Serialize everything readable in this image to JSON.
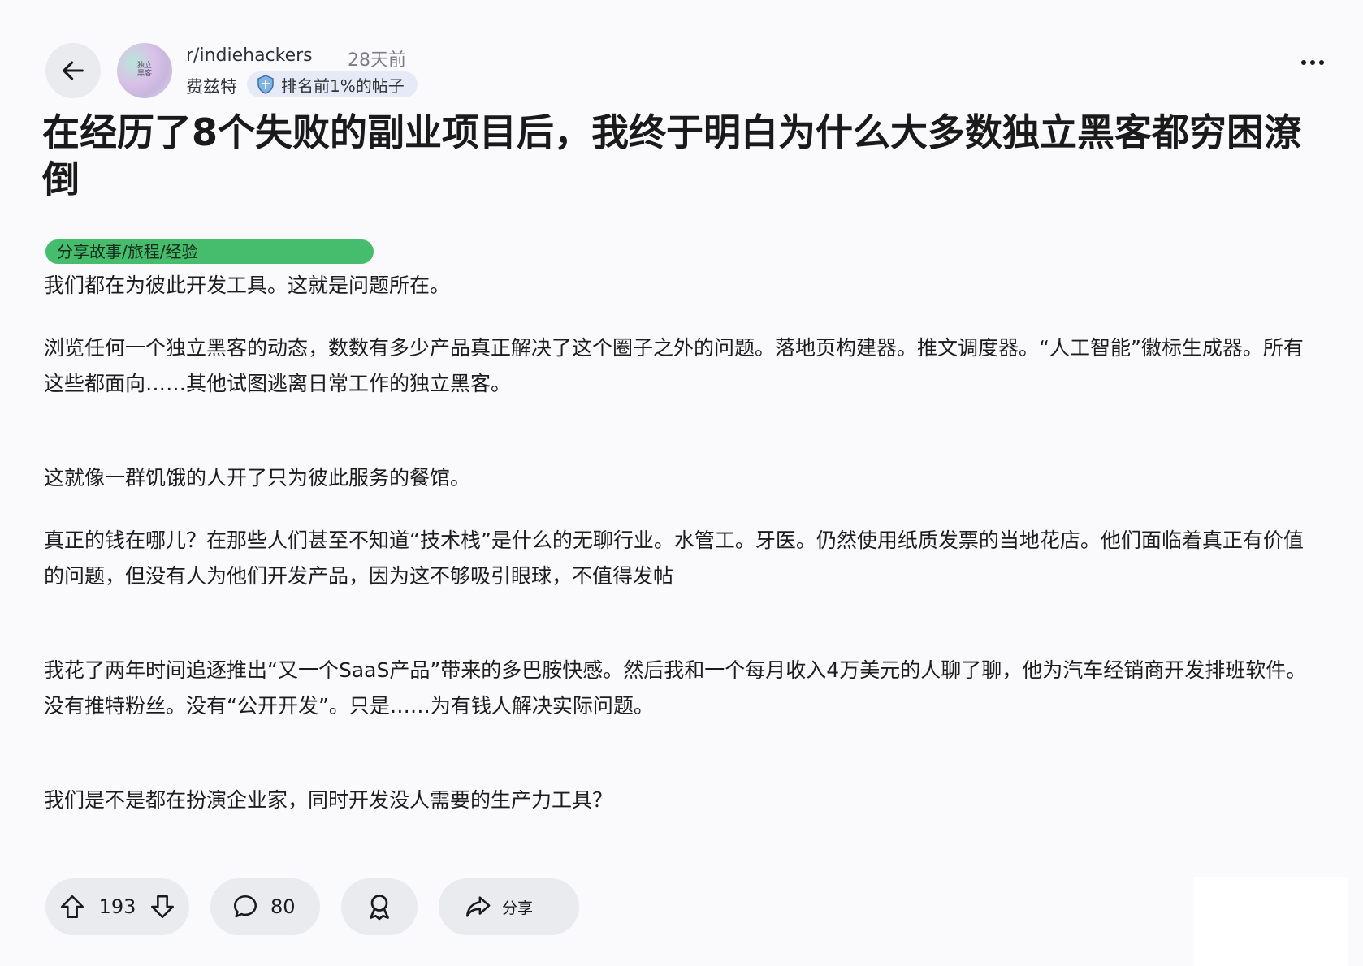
{
  "header": {
    "subreddit": "r/indiehackers",
    "time_ago": "28天前",
    "author": "费兹特",
    "rank_badge": "排名前1%的帖子",
    "avatar_text_line1": "独立",
    "avatar_text_line2": "黑客"
  },
  "post": {
    "title": "在经历了8个失败的副业项目后，我终于明白为什么大多数独立黑客都穷困潦倒",
    "flair": "分享故事/旅程/经验",
    "paragraphs": [
      "我们都在为彼此开发工具。这就是问题所在。",
      "浏览任何一个独立黑客的动态，数数有多少产品真正解决了这个圈子之外的问题。落地页构建器。推文调度器。“人工智能”徽标生成器。所有这些都面向……其他试图逃离日常工作的独立黑客。",
      "这就像一群饥饿的人开了只为彼此服务的餐馆。",
      "真正的钱在哪儿？在那些人们甚至不知道“技术栈”是什么的无聊行业。水管工。牙医。仍然使用纸质发票的当地花店。他们面临着真正有价值的问题，但没有人为他们开发产品，因为这不够吸引眼球，不值得发帖",
      "我花了两年时间追逐推出“又一个SaaS产品”带来的多巴胺快感。然后我和一个每月收入4万美元的人聊了聊，他为汽车经销商开发排班软件。没有推特粉丝。没有“公开开发”。只是……为有钱人解决实际问题。",
      "我们是不是都在扮演企业家，同时开发没人需要的生产力工具？"
    ]
  },
  "actions": {
    "upvotes": "193",
    "comments": "80",
    "share_label": "分享"
  },
  "colors": {
    "flair_bg": "#46bd6c",
    "pill_bg": "#e9ebef",
    "page_bg": "#fafafc"
  },
  "icons": [
    "back-arrow-icon",
    "more-options-icon",
    "rank-shield-icon",
    "upvote-icon",
    "downvote-icon",
    "comment-icon",
    "award-icon",
    "share-icon"
  ]
}
